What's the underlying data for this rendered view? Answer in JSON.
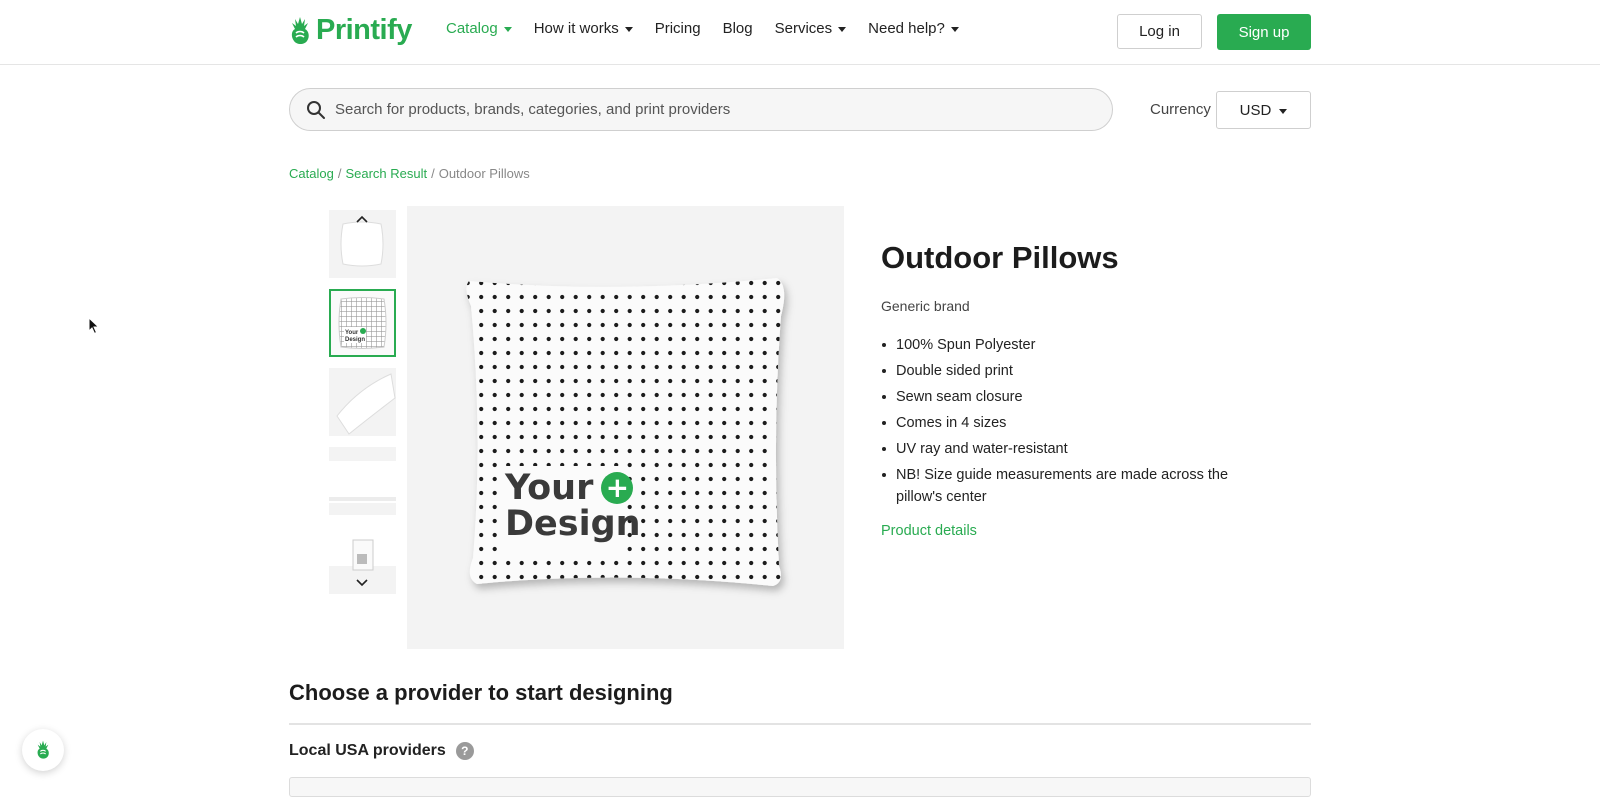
{
  "brand": {
    "name": "Printify",
    "accent": "#29ab51"
  },
  "nav": {
    "items": [
      {
        "label": "Catalog",
        "dropdown": true,
        "active": true
      },
      {
        "label": "How it works",
        "dropdown": true,
        "active": false
      },
      {
        "label": "Pricing",
        "dropdown": false,
        "active": false
      },
      {
        "label": "Blog",
        "dropdown": false,
        "active": false
      },
      {
        "label": "Services",
        "dropdown": true,
        "active": false
      },
      {
        "label": "Need help?",
        "dropdown": true,
        "active": false
      }
    ],
    "login": "Log in",
    "signup": "Sign up"
  },
  "search": {
    "placeholder": "Search for products, brands, categories, and print providers",
    "value": ""
  },
  "currency": {
    "label": "Currency",
    "value": "USD"
  },
  "breadcrumb": {
    "catalog": "Catalog",
    "search_result": "Search Result",
    "current": "Outdoor Pillows"
  },
  "product": {
    "title": "Outdoor Pillows",
    "brand": "Generic brand",
    "features": [
      "100% Spun Polyester",
      "Double sided print",
      "Sewn seam closure",
      "Comes in 4 sizes",
      "UV ray and water-resistant",
      "NB! Size guide measurements are made across the pillow's center"
    ],
    "details_link": "Product details",
    "image_overlay": {
      "line1": "Your",
      "line2": "Design"
    }
  },
  "thumbnails": {
    "count": 5,
    "selected_index": 1
  },
  "providers": {
    "heading": "Choose a provider to start designing",
    "local_label": "Local USA providers",
    "help_glyph": "?"
  }
}
